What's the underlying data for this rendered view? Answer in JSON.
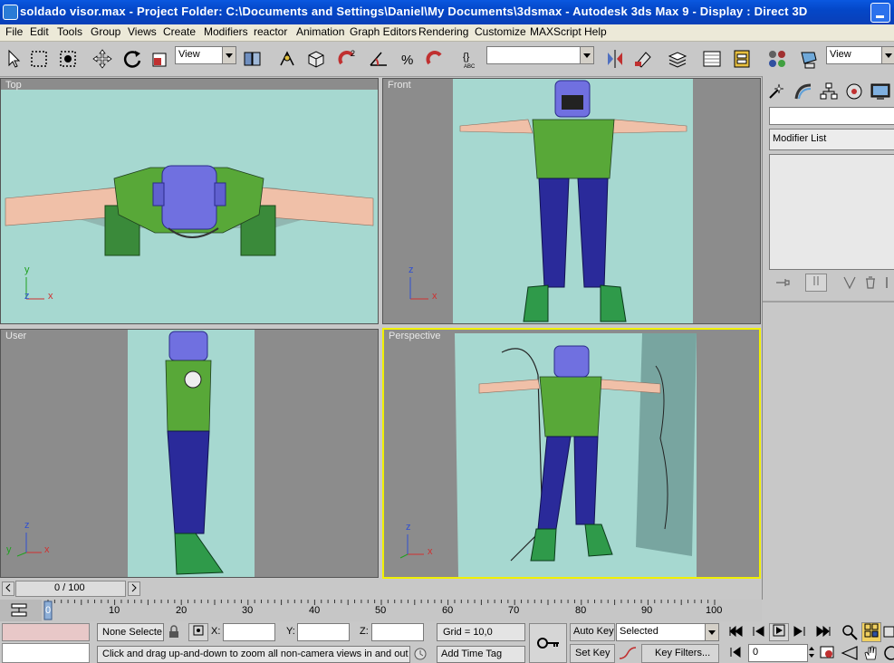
{
  "window": {
    "title": "soldado visor.max   - Project Folder: C:\\Documents and Settings\\Daniel\\My Documents\\3dsmax   - Autodesk 3ds Max 9    - Display : Direct 3D"
  },
  "menu": [
    "File",
    "Edit",
    "Tools",
    "Group",
    "Views",
    "Create",
    "Modifiers",
    "reactor",
    "Animation",
    "Graph Editors",
    "Rendering",
    "Customize",
    "MAXScript",
    "Help"
  ],
  "toolbar": {
    "ref_coord": "View",
    "named_selection": "",
    "view_right": "View"
  },
  "viewports": {
    "top": {
      "label": "Top"
    },
    "front": {
      "label": "Front"
    },
    "user": {
      "label": "User"
    },
    "perspective": {
      "label": "Perspective"
    }
  },
  "axes": {
    "x": "x",
    "y": "y",
    "z": "z"
  },
  "command_panel": {
    "name_field": "",
    "modifier_list": "Modifier List"
  },
  "timeline": {
    "slider_label": "0 / 100",
    "ticks": [
      "0",
      "10",
      "20",
      "30",
      "40",
      "50",
      "60",
      "70",
      "80",
      "90",
      "100"
    ]
  },
  "status": {
    "selection": "None Selecte",
    "x_label": "X:",
    "y_label": "Y:",
    "z_label": "Z:",
    "grid": "Grid = 10,0",
    "prompt": "Click and drag up-and-down to zoom all non-camera views in and out",
    "add_time_tag": "Add Time Tag",
    "auto_key": "Auto Key",
    "set_key": "Set Key",
    "key_mode": "Selected",
    "key_filters": "Key Filters...",
    "frame": "0"
  }
}
